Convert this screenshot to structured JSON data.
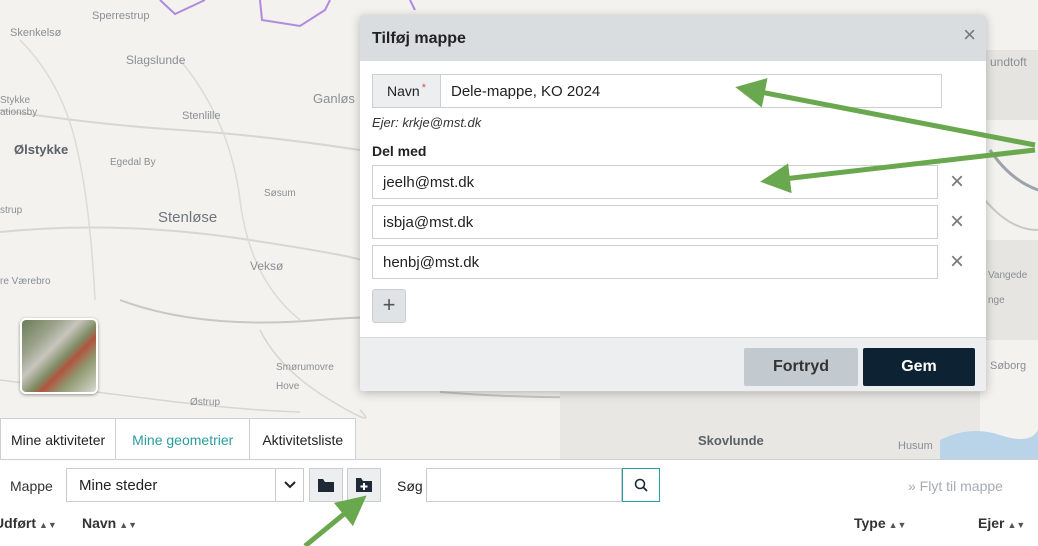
{
  "map": {
    "places": [
      {
        "name": "Skenkelsø"
      },
      {
        "name": "Sperrestrup"
      },
      {
        "name": "Slagslunde"
      },
      {
        "name": "Stykke"
      },
      {
        "name": "ationsby"
      },
      {
        "name": "Stenlille"
      },
      {
        "name": "Ganløs"
      },
      {
        "name": "Ølstykke"
      },
      {
        "name": "Egedal By"
      },
      {
        "name": "Søsum"
      },
      {
        "name": "strup"
      },
      {
        "name": "Stenløse"
      },
      {
        "name": "Veksø"
      },
      {
        "name": "re Værebro"
      },
      {
        "name": "Smørumovre"
      },
      {
        "name": "Hove"
      },
      {
        "name": "Østrup"
      },
      {
        "name": "Skovlunde"
      },
      {
        "name": "Husum"
      },
      {
        "name": "undtoft"
      },
      {
        "name": "Vangede"
      },
      {
        "name": "nge"
      },
      {
        "name": "Søborg"
      }
    ]
  },
  "dialog": {
    "title": "Tilføj mappe",
    "close_icon": "×",
    "name_label": "Navn",
    "required_mark": "*",
    "name_value": "Dele-mappe, KO 2024",
    "owner_text": "Ejer: krkje@mst.dk",
    "share_title": "Del med",
    "shares": [
      "jeelh@mst.dk",
      "isbja@mst.dk",
      "henbj@mst.dk"
    ],
    "remove_icon": "×",
    "add_icon": "+",
    "cancel_label": "Fortryd",
    "save_label": "Gem"
  },
  "tabs": [
    {
      "label": "Mine aktiviteter",
      "active": false
    },
    {
      "label": "Mine geometrier",
      "active": true
    },
    {
      "label": "Aktivitetsliste",
      "active": false
    }
  ],
  "toolbar": {
    "folder_label": "Mappe",
    "folder_value": "Mine steder",
    "search_label": "Søg",
    "search_value": "",
    "move_link": "» Flyt til mappe"
  },
  "columns": {
    "udfort": "Udført",
    "navn": "Navn",
    "type": "Type",
    "ejer": "Ejer"
  },
  "colors": {
    "accent": "#2a9d9f",
    "save_button": "#0d2233",
    "annotation_arrow": "#6aa84f"
  }
}
